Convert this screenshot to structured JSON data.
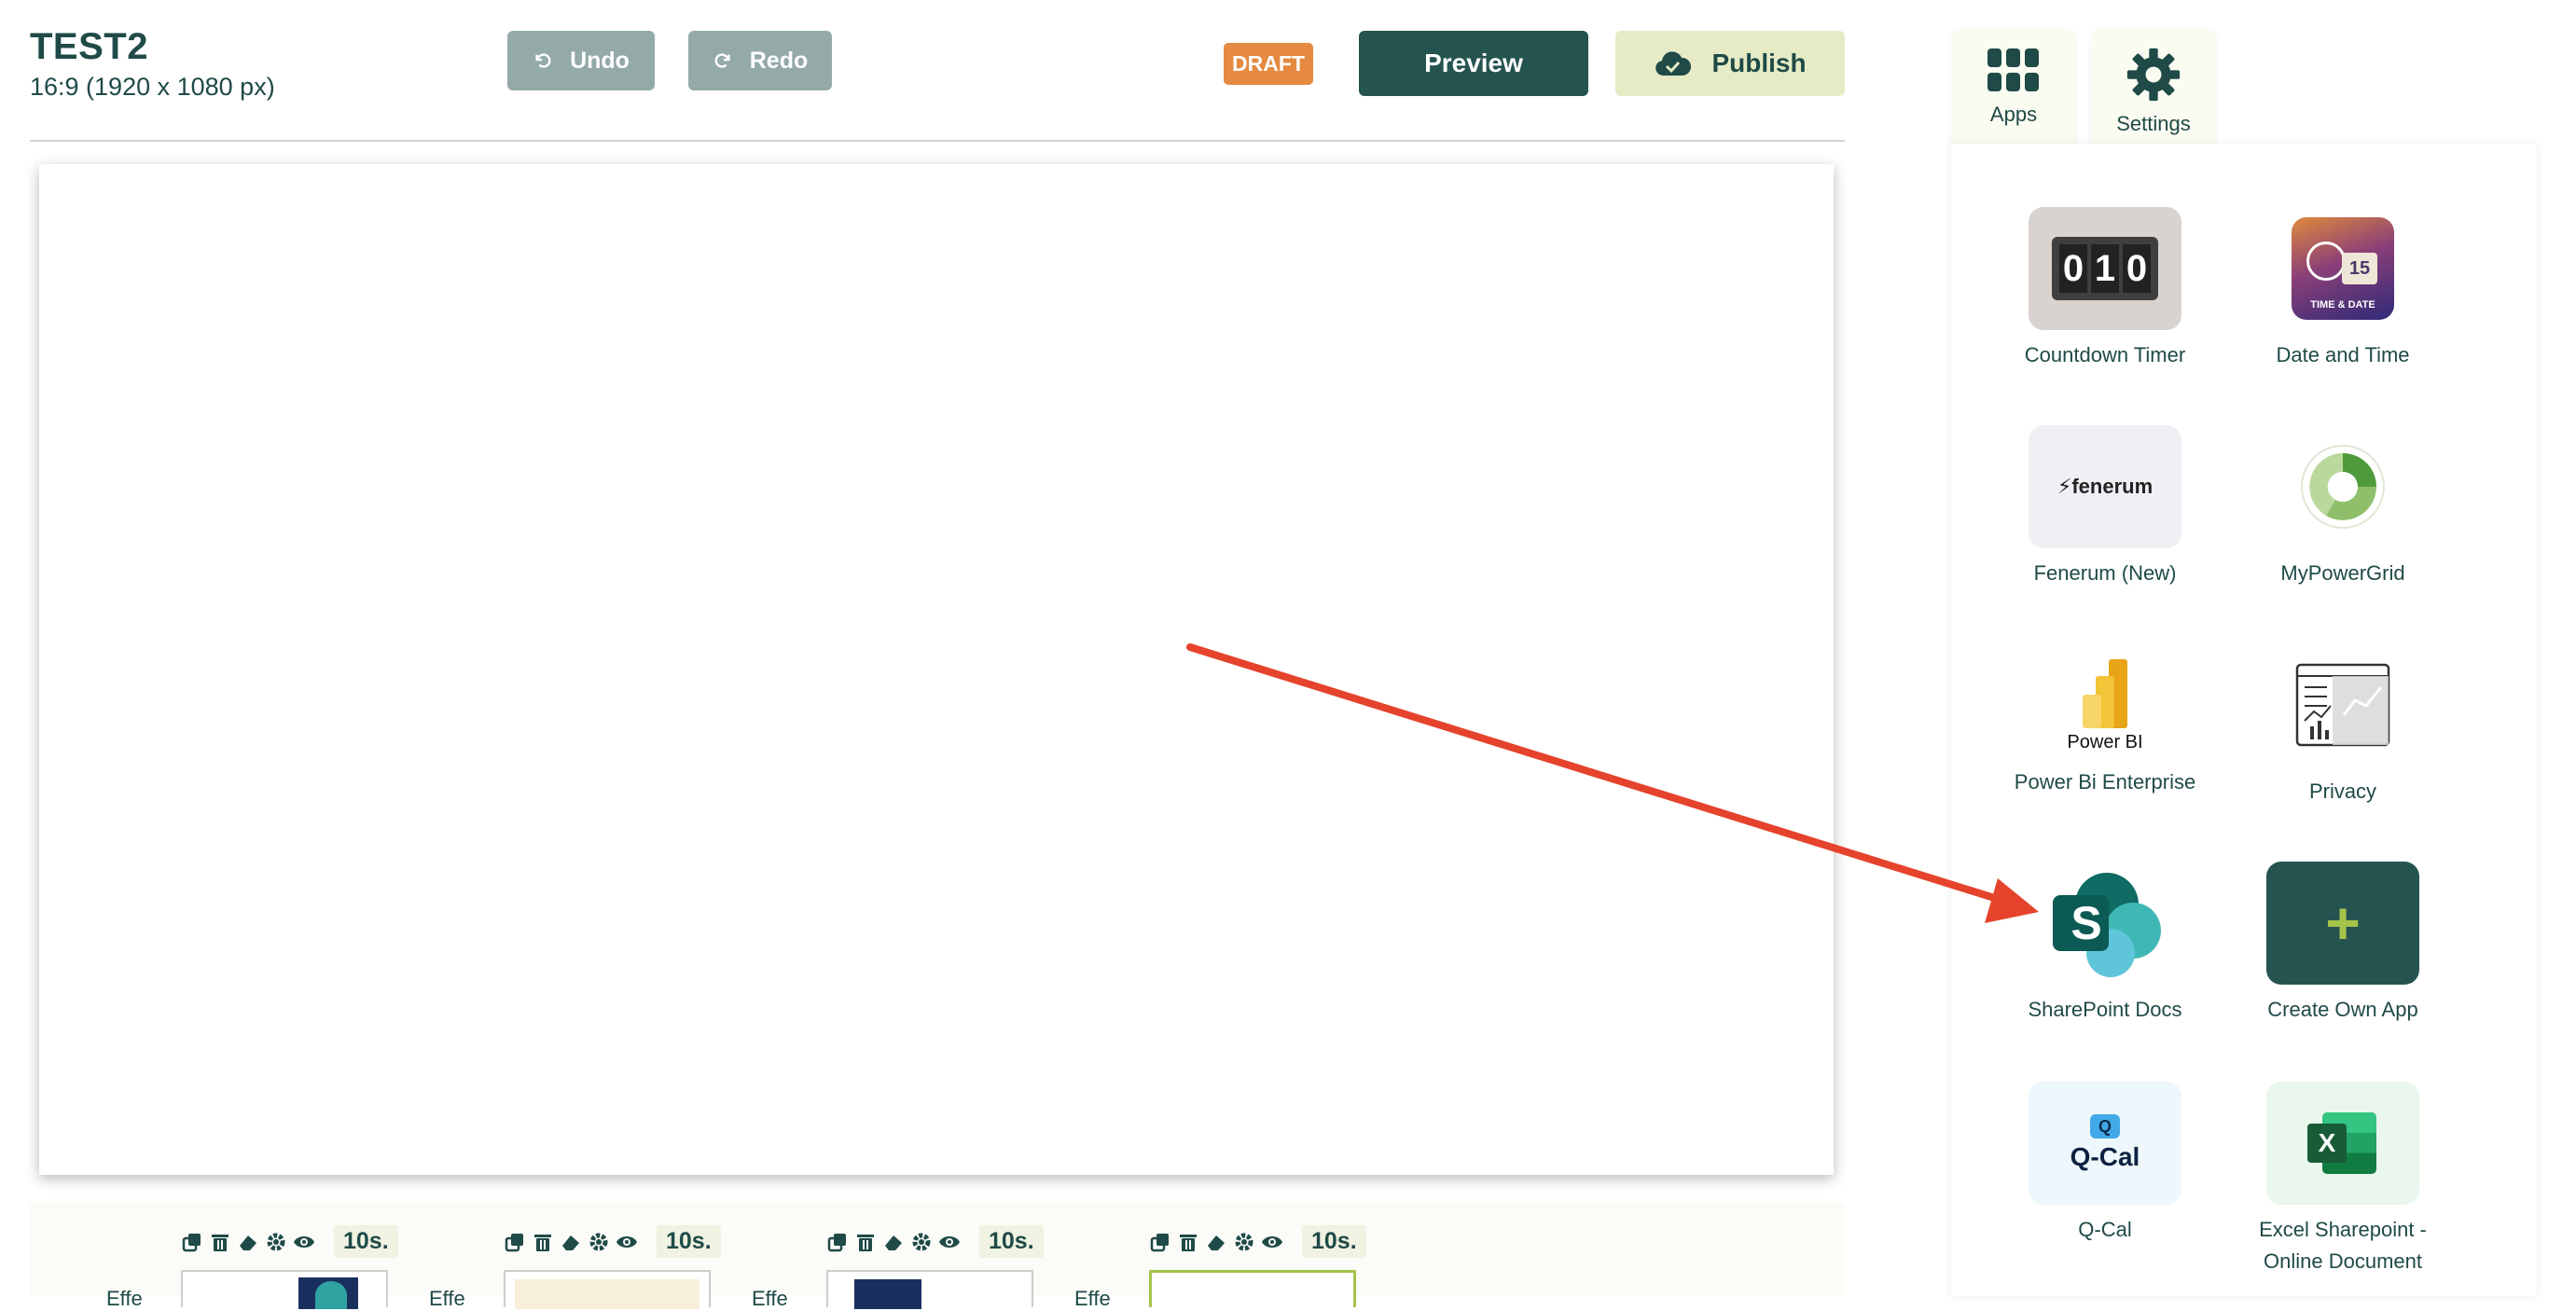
{
  "header": {
    "title": "TEST2",
    "subtitle": "16:9 (1920 x 1080 px)",
    "undo_label": "Undo",
    "redo_label": "Redo",
    "status_badge": "DRAFT",
    "preview_label": "Preview",
    "publish_label": "Publish"
  },
  "tabs": {
    "apps_label": "Apps",
    "settings_label": "Settings"
  },
  "apps": [
    {
      "label": "Countdown Timer",
      "digits": [
        "0",
        "1",
        "0"
      ]
    },
    {
      "label": "Date and Time",
      "icon_text": "TIME & DATE",
      "day": "15"
    },
    {
      "label": "Fenerum (New)",
      "icon_text": "fenerum"
    },
    {
      "label": "MyPowerGrid"
    },
    {
      "label": "Power Bi Enterprise",
      "icon_text": "Power BI"
    },
    {
      "label": "Privacy"
    },
    {
      "label": "SharePoint Docs",
      "icon_text": "S"
    },
    {
      "label": "Create Own App",
      "icon_text": "+"
    },
    {
      "label": "Q-Cal",
      "icon_text": "Q-Cal"
    },
    {
      "label": "Excel Sharepoint - Online Document",
      "icon_text": "X"
    }
  ],
  "timeline": {
    "slides": [
      {
        "duration": "10s."
      },
      {
        "duration": "10s."
      },
      {
        "duration": "10s."
      },
      {
        "duration": "10s."
      }
    ],
    "effect_label": "Effe"
  },
  "colors": {
    "primary": "#255450",
    "draft": "#e58a40",
    "publish_bg": "#e6ebc6",
    "disabled_btn": "#94aaa9",
    "annotation_arrow": "#e5432c"
  }
}
